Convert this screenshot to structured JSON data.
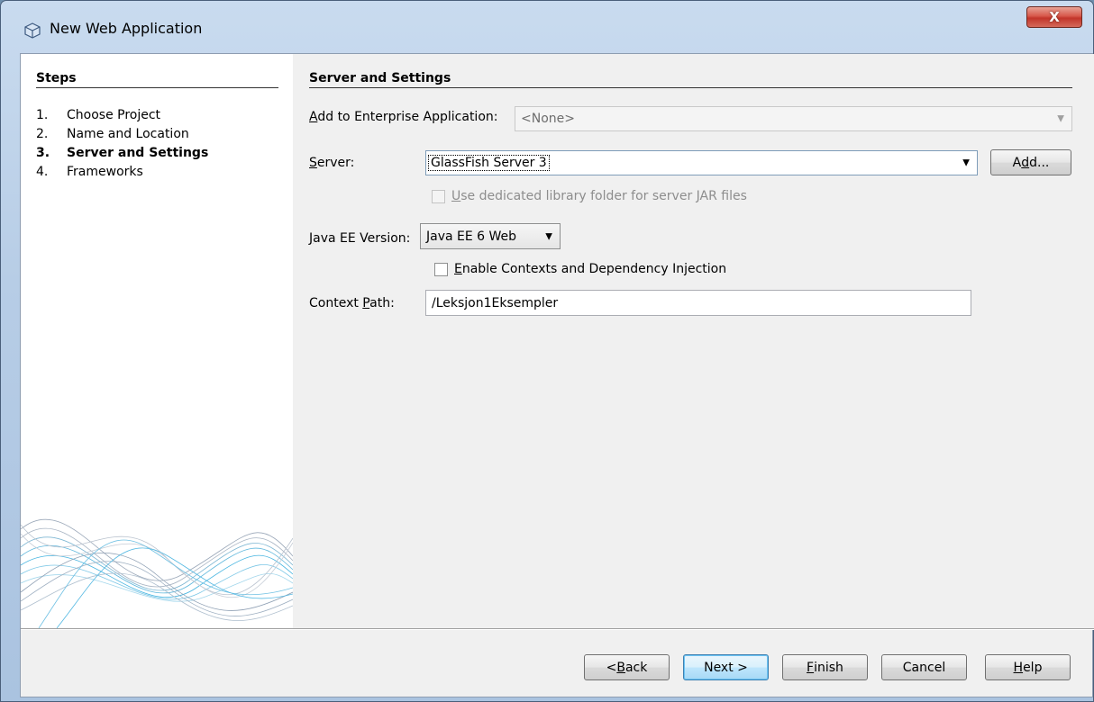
{
  "window": {
    "title": "New Web Application",
    "close_label": "X"
  },
  "steps": {
    "title": "Steps",
    "items": [
      {
        "num": "1.",
        "label": "Choose Project",
        "active": false
      },
      {
        "num": "2.",
        "label": "Name and Location",
        "active": false
      },
      {
        "num": "3.",
        "label": "Server and Settings",
        "active": true
      },
      {
        "num": "4.",
        "label": "Frameworks",
        "active": false
      }
    ]
  },
  "main": {
    "title": "Server and Settings",
    "enterprise_label_mn": "A",
    "enterprise_label_rest": "dd to Enterprise Application:",
    "enterprise_value": "<None>",
    "server_label_mn": "S",
    "server_label_rest": "erver:",
    "server_value": "GlassFish Server 3",
    "add_button_pre": "A",
    "add_button_mn": "d",
    "add_button_post": "d...",
    "dedicated_lib_mn": "U",
    "dedicated_lib_rest": "se dedicated library folder for server JAR files",
    "javaee_label_mn": "J",
    "javaee_label_rest": "ava EE Version:",
    "javaee_value": "Java EE 6 Web",
    "cdi_mn": "E",
    "cdi_rest": "nable Contexts and Dependency Injection",
    "context_label_pre": "Context ",
    "context_label_mn": "P",
    "context_label_post": "ath:",
    "context_value": "/Leksjon1Eksempler"
  },
  "footer": {
    "back_pre": "< ",
    "back_mn": "B",
    "back_post": "ack",
    "next": "Next >",
    "finish_mn": "F",
    "finish_rest": "inish",
    "cancel": "Cancel",
    "help_mn": "H",
    "help_rest": "elp"
  }
}
